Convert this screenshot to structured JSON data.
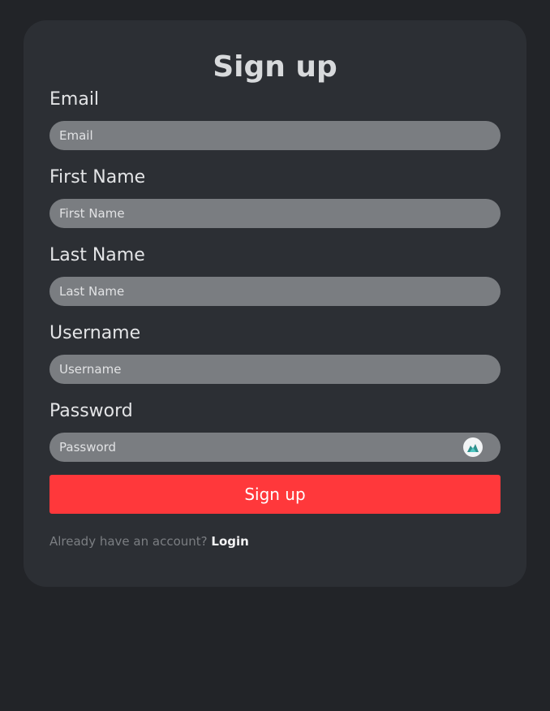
{
  "form": {
    "title": "Sign up",
    "fields": [
      {
        "label": "Email",
        "placeholder": "Email"
      },
      {
        "label": "First Name",
        "placeholder": "First Name"
      },
      {
        "label": "Last Name",
        "placeholder": "Last Name"
      },
      {
        "label": "Username",
        "placeholder": "Username"
      },
      {
        "label": "Password",
        "placeholder": "Password"
      }
    ],
    "password_icon": "password-manager-icon",
    "submit_label": "Sign up",
    "footer_text": "Already have an account? ",
    "login_link": "Login"
  },
  "colors": {
    "page_background": "#222428",
    "card_background": "#2c2f34",
    "input_background": "#7a7d81",
    "accent": "#ff383b",
    "title_text": "#d8dadc",
    "muted_text": "#7b7e82"
  }
}
